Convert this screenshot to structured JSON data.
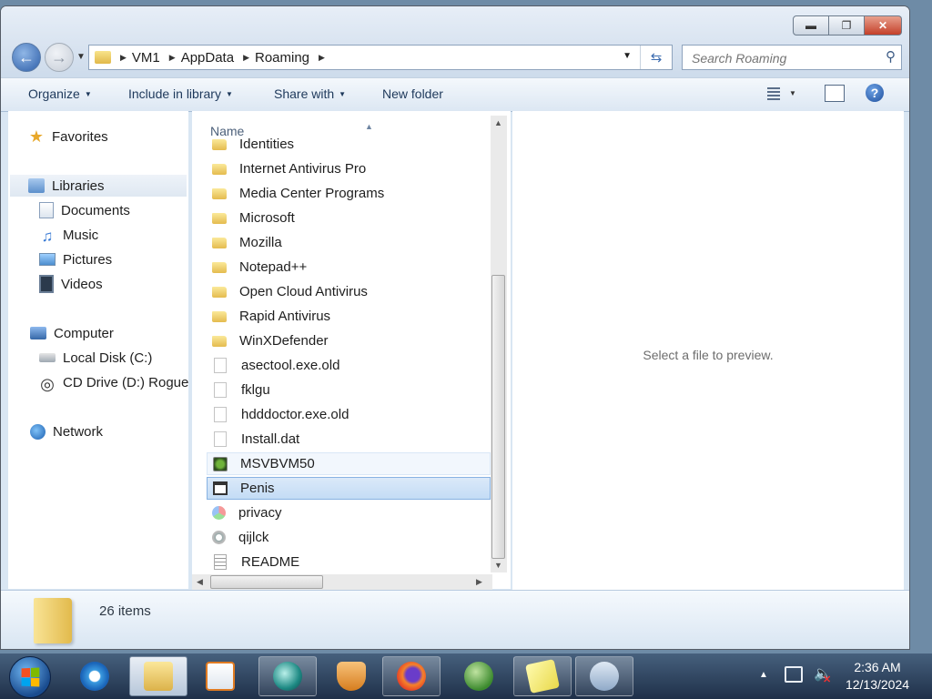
{
  "window": {
    "minimize_icon": "minimize-icon",
    "maximize_icon": "maximize-icon",
    "close_icon": "close-icon"
  },
  "address_bar": {
    "crumbs": [
      "VM1",
      "AppData",
      "Roaming"
    ]
  },
  "search": {
    "placeholder": "Search Roaming"
  },
  "toolbar": {
    "organize": "Organize",
    "include_in_library": "Include in library",
    "share_with": "Share with",
    "new_folder": "New folder"
  },
  "nav_pane": {
    "favorites": "Favorites",
    "libraries": "Libraries",
    "documents": "Documents",
    "music": "Music",
    "pictures": "Pictures",
    "videos": "Videos",
    "computer": "Computer",
    "local_disk": "Local Disk (C:)",
    "cd_drive": "CD Drive (D:) Rogue",
    "network": "Network"
  },
  "file_list": {
    "column_name": "Name",
    "partial_top_item": "Identities",
    "items": [
      {
        "name": "Internet Antivirus Pro",
        "icon": "folder-icon"
      },
      {
        "name": "Media Center Programs",
        "icon": "folder-icon"
      },
      {
        "name": "Microsoft",
        "icon": "folder-icon"
      },
      {
        "name": "Mozilla",
        "icon": "folder-icon"
      },
      {
        "name": "Notepad++",
        "icon": "folder-icon"
      },
      {
        "name": "Open Cloud Antivirus",
        "icon": "folder-icon"
      },
      {
        "name": "Rapid Antivirus",
        "icon": "folder-icon"
      },
      {
        "name": "WinXDefender",
        "icon": "folder-icon"
      },
      {
        "name": "asectool.exe.old",
        "icon": "file-icon"
      },
      {
        "name": "fklgu",
        "icon": "file-icon"
      },
      {
        "name": "hdddoctor.exe.old",
        "icon": "file-icon"
      },
      {
        "name": "Install.dat",
        "icon": "file-icon"
      },
      {
        "name": "MSVBVM50",
        "icon": "exe-icon"
      },
      {
        "name": "Penis",
        "icon": "window-icon"
      },
      {
        "name": "privacy",
        "icon": "privacy-icon"
      },
      {
        "name": "qijlck",
        "icon": "gear-icon"
      },
      {
        "name": "README",
        "icon": "text-file-icon"
      }
    ]
  },
  "preview": {
    "message": "Select a file to preview."
  },
  "details": {
    "item_count": "26 items"
  },
  "taskbar": {
    "pinned": [
      "internet-explorer-icon",
      "windows-explorer-icon",
      "media-player-icon",
      "chat-icon",
      "shield-icon",
      "firefox-icon",
      "windows-logo-icon",
      "sticky-notes-icon",
      "installer-icon"
    ],
    "clock_time": "2:36 AM",
    "clock_date": "12/13/2024"
  }
}
